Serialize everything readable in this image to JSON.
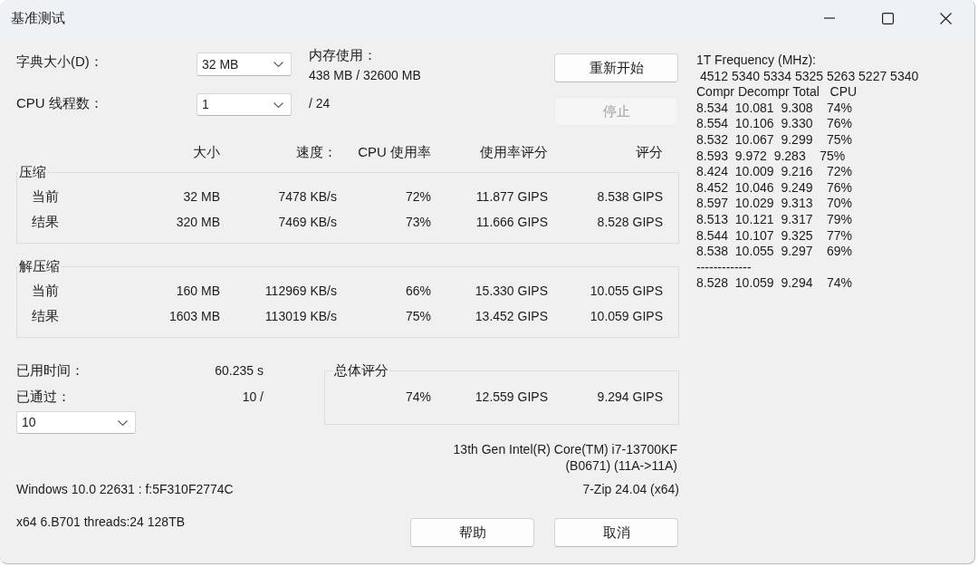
{
  "window": {
    "title": "基准测试"
  },
  "settings": [
    {
      "label": "字典大小(D)：",
      "value": "32 MB"
    },
    {
      "label": "CPU 线程数：",
      "value": "1"
    }
  ],
  "memory": {
    "label": "内存使用：",
    "value": "438 MB / 32600 MB"
  },
  "threads_max": "/ 24",
  "top_buttons": [
    {
      "label": "重新开始",
      "disabled": false
    },
    {
      "label": "停止",
      "disabled": true
    }
  ],
  "table": {
    "columns": [
      "大小",
      "速度：",
      "CPU 使用率",
      "使用率评分",
      "评分"
    ],
    "groups": [
      {
        "title": "压缩",
        "rows": [
          {
            "label": "当前",
            "cells": [
              "32 MB",
              "7478 KB/s",
              "72%",
              "11.877 GIPS",
              "8.538 GIPS"
            ]
          },
          {
            "label": "结果",
            "cells": [
              "320 MB",
              "7469 KB/s",
              "73%",
              "11.666 GIPS",
              "8.528 GIPS"
            ]
          }
        ]
      },
      {
        "title": "解压缩",
        "rows": [
          {
            "label": "当前",
            "cells": [
              "160 MB",
              "112969 KB/s",
              "66%",
              "15.330 GIPS",
              "10.055 GIPS"
            ]
          },
          {
            "label": "结果",
            "cells": [
              "1603 MB",
              "113019 KB/s",
              "75%",
              "13.452 GIPS",
              "10.059 GIPS"
            ]
          }
        ]
      }
    ]
  },
  "elapsed": {
    "label": "已用时间：",
    "value": "60.235 s"
  },
  "passes": {
    "label": "已通过：",
    "value": "10 /",
    "count": "10"
  },
  "total": {
    "title": "总体评分",
    "cells": [
      "74%",
      "12.559 GIPS",
      "9.294 GIPS"
    ]
  },
  "cpu_info": [
    "13th Gen Intel(R) Core(TM) i7-13700KF",
    "(B0671) (11A->11A)"
  ],
  "system_info": "Windows 10.0 22631 : f:5F310F2774C",
  "version": "7-Zip 24.04 (x64)",
  "arch_info": "x64 6.B701 threads:24 128TB",
  "bottom_buttons": [
    {
      "label": "帮助",
      "disabled": false
    },
    {
      "label": "取消",
      "disabled": false
    }
  ],
  "log": {
    "lines": [
      "1T Frequency (MHz):",
      " 4512 5340 5334 5325 5263 5227 5340",
      "Compr Decompr Total   CPU",
      "8.534  10.081  9.308    74%",
      "8.554  10.106  9.330    76%",
      "8.532  10.067  9.299    75%",
      "8.593  9.972  9.283    75%",
      "8.424  10.009  9.216    72%",
      "8.452  10.046  9.249    76%",
      "8.597  10.029  9.313    70%",
      "8.513  10.121  9.317    79%",
      "8.544  10.107  9.325    77%",
      "8.538  10.055  9.297    69%",
      "-------------",
      "8.528  10.059  9.294    74%"
    ]
  }
}
